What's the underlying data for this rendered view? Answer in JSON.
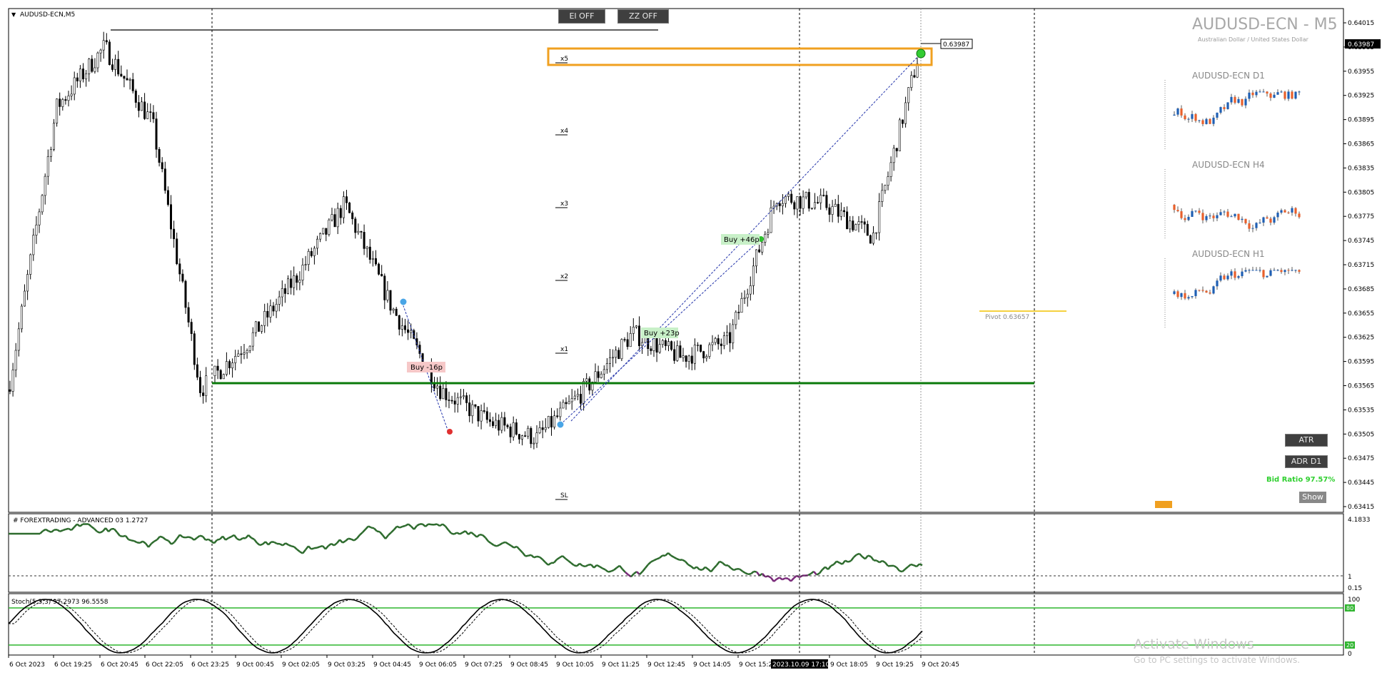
{
  "chart_title": "AUDUSD-ECN,M5",
  "buttons": {
    "ei": "EI OFF",
    "zz": "ZZ OFF",
    "atr": "ATR",
    "adr": "ADR D1",
    "show": "Show"
  },
  "symbol_title": "AUDUSD-ECN - M5",
  "symbol_subtitle": "Australian Dollar / United States Dollar",
  "bid_ratio": "Bid Ratio 97.57%",
  "pivot_label": "Pivot 0.63657",
  "current_price": "0.63987",
  "level_marks": [
    "x5",
    "x4",
    "x3",
    "x2",
    "x1",
    "SL"
  ],
  "trade_labels": [
    {
      "text": "Buy -16p",
      "kind": "loss"
    },
    {
      "text": "Buy +23p",
      "kind": "win"
    },
    {
      "text": "Buy +46p",
      "kind": "win"
    }
  ],
  "mini_charts": [
    {
      "title": "AUDUSD-ECN D1"
    },
    {
      "title": "AUDUSD-ECN H4"
    },
    {
      "title": "AUDUSD-ECN H1"
    }
  ],
  "price_axis": [
    "0.64015",
    "0.63985",
    "0.63955",
    "0.63925",
    "0.63895",
    "0.63865",
    "0.63835",
    "0.63805",
    "0.63775",
    "0.63745",
    "0.63715",
    "0.63685",
    "0.63655",
    "0.63625",
    "0.63595",
    "0.63565",
    "0.63535",
    "0.63505",
    "0.63475",
    "0.63445",
    "0.63415"
  ],
  "time_axis": [
    "6 Oct 2023",
    "6 Oct 19:25",
    "6 Oct 20:45",
    "6 Oct 22:05",
    "6 Oct 23:25",
    "9 Oct 00:45",
    "9 Oct 02:05",
    "9 Oct 03:25",
    "9 Oct 04:45",
    "9 Oct 06:05",
    "9 Oct 07:25",
    "9 Oct 08:45",
    "9 Oct 10:05",
    "9 Oct 11:25",
    "9 Oct 12:45",
    "9 Oct 14:05",
    "9 Oct 15:2",
    "9 Oct 18:05",
    "9 Oct 19:25",
    "9 Oct 20:45"
  ],
  "cursor_time": "2023.10.09 17:10",
  "indicator1": {
    "label": "# FOREXTRADING - ADVANCED 03 1.2727",
    "axis": [
      "4.1833",
      "1",
      "0.15"
    ]
  },
  "indicator2": {
    "label": "Stoch(5,3,3) 97.2973 96.5558",
    "axis": [
      "100",
      "80",
      "20",
      "0"
    ]
  },
  "watermark": {
    "line1": "Activate Windows",
    "line2": "Go to PC settings to activate Windows."
  },
  "colors": {
    "bull": "#1f5fb4",
    "bear": "#e8602c",
    "support": "#0a7a0a",
    "highlight": "#f0a020",
    "pivot": "#f2c200",
    "osc_up": "#2d6b2d",
    "osc_down": "#7a2a7a",
    "stoch_level": "#2fb52f"
  },
  "chart_data": {
    "type": "line",
    "title": "AUDUSD-ECN,M5",
    "xlabel": "",
    "ylabel": "",
    "ylim": [
      0.63415,
      0.64015
    ],
    "x": [
      "6 Oct 2023",
      "6 Oct 19:25",
      "6 Oct 20:45",
      "6 Oct 22:05",
      "6 Oct 23:25",
      "9 Oct 00:45",
      "9 Oct 02:05",
      "9 Oct 03:25",
      "9 Oct 04:45",
      "9 Oct 06:05",
      "9 Oct 07:25",
      "9 Oct 08:45",
      "9 Oct 10:05",
      "9 Oct 11:25",
      "9 Oct 12:45",
      "9 Oct 14:05",
      "9 Oct 15:2",
      "9 Oct 18:05",
      "9 Oct 19:25",
      "9 Oct 20:45"
    ],
    "series": [
      {
        "name": "",
        "values": [
          0.6356,
          0.6391,
          0.63985,
          0.6389,
          0.6356,
          0.6362,
          0.637,
          0.6379,
          0.6366,
          0.6356,
          0.6352,
          0.635,
          0.6356,
          0.6363,
          0.636,
          0.6362,
          0.638,
          0.6379,
          0.6375,
          0.63987
        ]
      }
    ],
    "support_level": 0.63565,
    "pivot": 0.63657,
    "last_price": 0.63987
  }
}
